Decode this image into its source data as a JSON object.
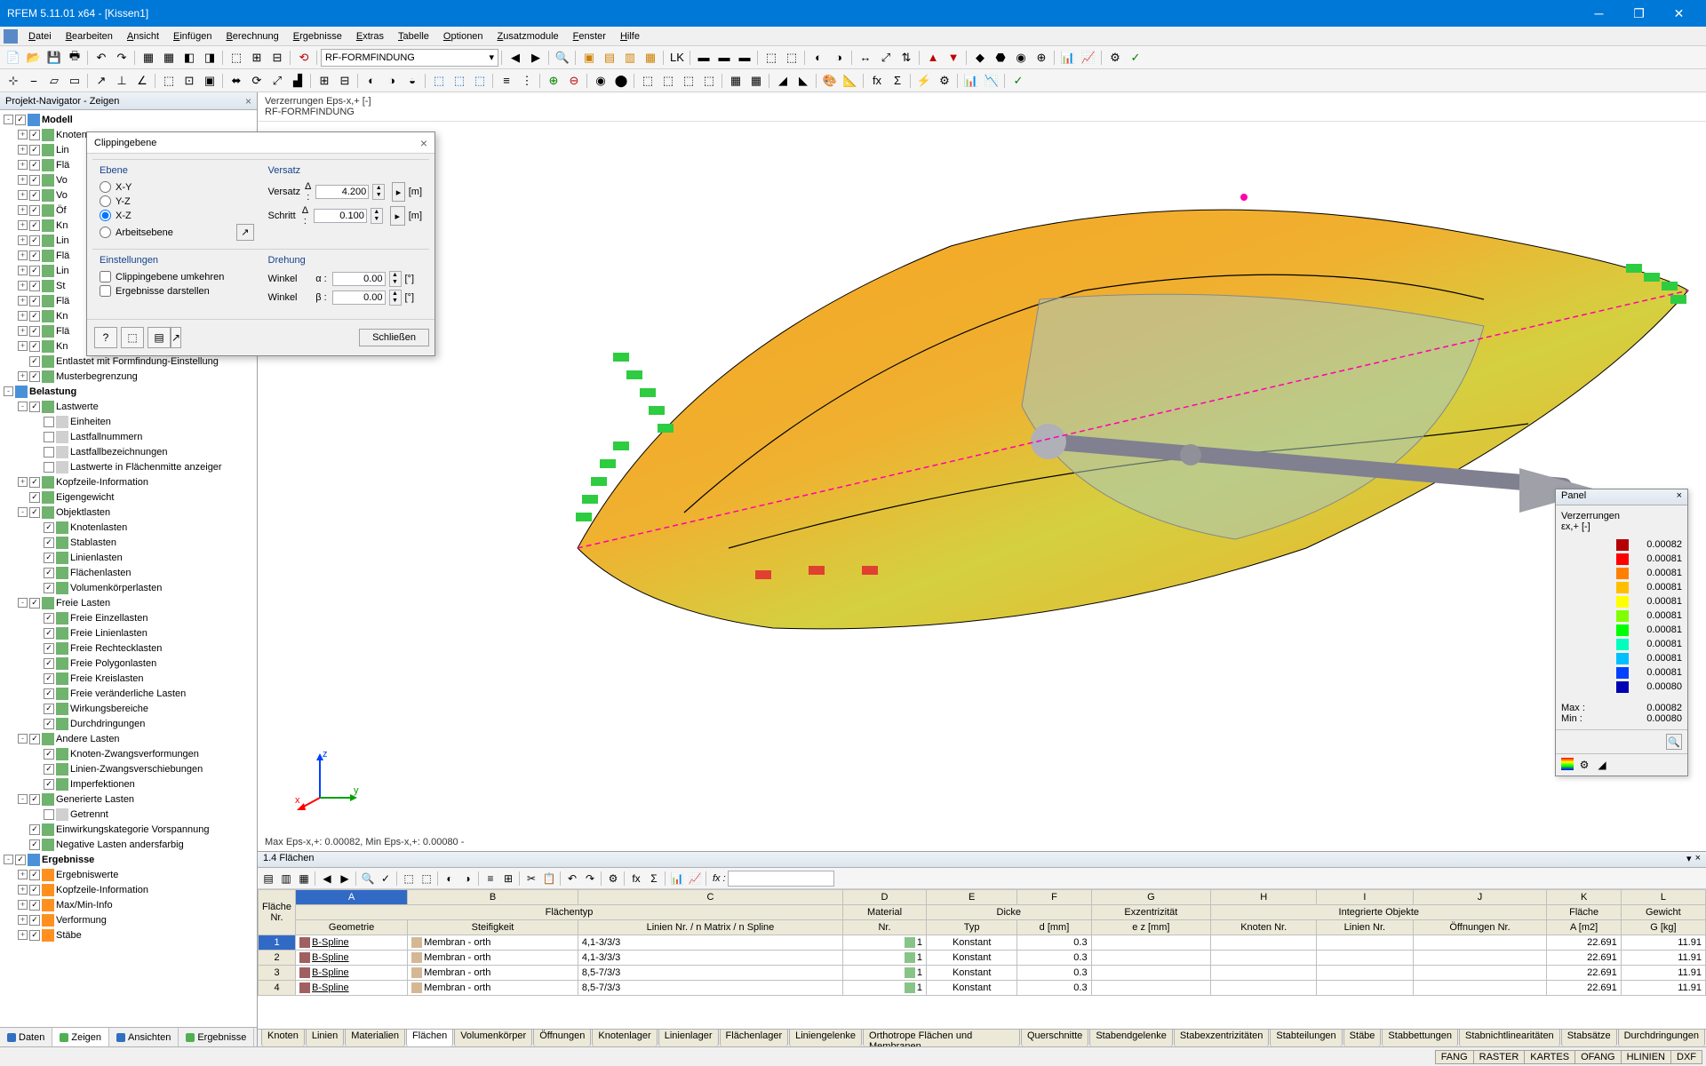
{
  "app": {
    "title": "RFEM 5.11.01 x64 - [Kissen1]"
  },
  "menu": [
    "Datei",
    "Bearbeiten",
    "Ansicht",
    "Einfügen",
    "Berechnung",
    "Ergebnisse",
    "Extras",
    "Tabelle",
    "Optionen",
    "Zusatzmodule",
    "Fenster",
    "Hilfe"
  ],
  "menu_accel": [
    "D",
    "B",
    "A",
    "E",
    "B",
    "E",
    "E",
    "T",
    "O",
    "Z",
    "F",
    "H"
  ],
  "module_dropdown": "RF-FORMFINDUNG",
  "navigator": {
    "title": "Projekt-Navigator - Zeigen",
    "tree": [
      {
        "d": 0,
        "tw": "-",
        "cb": true,
        "bold": true,
        "ic": "#4a90d9",
        "lbl": "Modell"
      },
      {
        "d": 1,
        "tw": "+",
        "cb": true,
        "ic": "#6fb36f",
        "lbl": "Knoten"
      },
      {
        "d": 1,
        "tw": "+",
        "cb": true,
        "ic": "#6fb36f",
        "lbl": "Lin"
      },
      {
        "d": 1,
        "tw": "+",
        "cb": true,
        "ic": "#6fb36f",
        "lbl": "Flä"
      },
      {
        "d": 1,
        "tw": "+",
        "cb": true,
        "ic": "#6fb36f",
        "lbl": "Vo"
      },
      {
        "d": 1,
        "tw": "+",
        "cb": true,
        "ic": "#6fb36f",
        "lbl": "Vo"
      },
      {
        "d": 1,
        "tw": "+",
        "cb": true,
        "ic": "#6fb36f",
        "lbl": "Öf"
      },
      {
        "d": 1,
        "tw": "+",
        "cb": true,
        "ic": "#6fb36f",
        "lbl": "Kn"
      },
      {
        "d": 1,
        "tw": "+",
        "cb": true,
        "ic": "#6fb36f",
        "lbl": "Lin"
      },
      {
        "d": 1,
        "tw": "+",
        "cb": true,
        "ic": "#6fb36f",
        "lbl": "Flä"
      },
      {
        "d": 1,
        "tw": "+",
        "cb": true,
        "ic": "#6fb36f",
        "lbl": "Lin"
      },
      {
        "d": 1,
        "tw": "+",
        "cb": true,
        "ic": "#6fb36f",
        "lbl": "St"
      },
      {
        "d": 1,
        "tw": "+",
        "cb": true,
        "ic": "#6fb36f",
        "lbl": "Flä"
      },
      {
        "d": 1,
        "tw": "+",
        "cb": true,
        "ic": "#6fb36f",
        "lbl": "Kn"
      },
      {
        "d": 1,
        "tw": "+",
        "cb": true,
        "ic": "#6fb36f",
        "lbl": "Flä"
      },
      {
        "d": 1,
        "tw": "+",
        "cb": true,
        "ic": "#6fb36f",
        "lbl": "Kn"
      },
      {
        "d": 1,
        "tw": " ",
        "cb": true,
        "ic": "#6fb36f",
        "lbl": "Entlastet mit Formfindung-Einstellung"
      },
      {
        "d": 1,
        "tw": "+",
        "cb": true,
        "ic": "#6fb36f",
        "lbl": "Musterbegrenzung"
      },
      {
        "d": 0,
        "tw": "-",
        "cb": null,
        "bold": true,
        "ic": "#4a90d9",
        "lbl": "Belastung"
      },
      {
        "d": 1,
        "tw": "-",
        "cb": true,
        "ic": "#6fb36f",
        "lbl": "Lastwerte"
      },
      {
        "d": 2,
        "tw": " ",
        "cb": false,
        "ic": "#d0d0d0",
        "lbl": "Einheiten"
      },
      {
        "d": 2,
        "tw": " ",
        "cb": false,
        "ic": "#d0d0d0",
        "lbl": "Lastfallnummern"
      },
      {
        "d": 2,
        "tw": " ",
        "cb": false,
        "ic": "#d0d0d0",
        "lbl": "Lastfallbezeichnungen"
      },
      {
        "d": 2,
        "tw": " ",
        "cb": false,
        "ic": "#d0d0d0",
        "lbl": "Lastwerte in Flächenmitte anzeiger"
      },
      {
        "d": 1,
        "tw": "+",
        "cb": true,
        "ic": "#6fb36f",
        "lbl": "Kopfzeile-Information"
      },
      {
        "d": 1,
        "tw": " ",
        "cb": true,
        "ic": "#6fb36f",
        "lbl": "Eigengewicht"
      },
      {
        "d": 1,
        "tw": "-",
        "cb": true,
        "ic": "#6fb36f",
        "lbl": "Objektlasten"
      },
      {
        "d": 2,
        "tw": " ",
        "cb": true,
        "ic": "#6fb36f",
        "lbl": "Knotenlasten"
      },
      {
        "d": 2,
        "tw": " ",
        "cb": true,
        "ic": "#6fb36f",
        "lbl": "Stablasten"
      },
      {
        "d": 2,
        "tw": " ",
        "cb": true,
        "ic": "#6fb36f",
        "lbl": "Linienlasten"
      },
      {
        "d": 2,
        "tw": " ",
        "cb": true,
        "ic": "#6fb36f",
        "lbl": "Flächenlasten"
      },
      {
        "d": 2,
        "tw": " ",
        "cb": true,
        "ic": "#6fb36f",
        "lbl": "Volumenkörperlasten"
      },
      {
        "d": 1,
        "tw": "-",
        "cb": true,
        "ic": "#6fb36f",
        "lbl": "Freie Lasten"
      },
      {
        "d": 2,
        "tw": " ",
        "cb": true,
        "ic": "#6fb36f",
        "lbl": "Freie Einzellasten"
      },
      {
        "d": 2,
        "tw": " ",
        "cb": true,
        "ic": "#6fb36f",
        "lbl": "Freie Linienlasten"
      },
      {
        "d": 2,
        "tw": " ",
        "cb": true,
        "ic": "#6fb36f",
        "lbl": "Freie Rechtecklasten"
      },
      {
        "d": 2,
        "tw": " ",
        "cb": true,
        "ic": "#6fb36f",
        "lbl": "Freie Polygonlasten"
      },
      {
        "d": 2,
        "tw": " ",
        "cb": true,
        "ic": "#6fb36f",
        "lbl": "Freie Kreislasten"
      },
      {
        "d": 2,
        "tw": " ",
        "cb": true,
        "ic": "#6fb36f",
        "lbl": "Freie veränderliche Lasten"
      },
      {
        "d": 2,
        "tw": " ",
        "cb": true,
        "ic": "#6fb36f",
        "lbl": "Wirkungsbereiche"
      },
      {
        "d": 2,
        "tw": " ",
        "cb": true,
        "ic": "#6fb36f",
        "lbl": "Durchdringungen"
      },
      {
        "d": 1,
        "tw": "-",
        "cb": true,
        "ic": "#6fb36f",
        "lbl": "Andere Lasten"
      },
      {
        "d": 2,
        "tw": " ",
        "cb": true,
        "ic": "#6fb36f",
        "lbl": "Knoten-Zwangsverformungen"
      },
      {
        "d": 2,
        "tw": " ",
        "cb": true,
        "ic": "#6fb36f",
        "lbl": "Linien-Zwangsverschiebungen"
      },
      {
        "d": 2,
        "tw": " ",
        "cb": true,
        "ic": "#6fb36f",
        "lbl": "Imperfektionen"
      },
      {
        "d": 1,
        "tw": "-",
        "cb": true,
        "ic": "#6fb36f",
        "lbl": "Generierte Lasten"
      },
      {
        "d": 2,
        "tw": " ",
        "cb": false,
        "ic": "#d0d0d0",
        "lbl": "Getrennt"
      },
      {
        "d": 1,
        "tw": " ",
        "cb": true,
        "ic": "#6fb36f",
        "lbl": "Einwirkungskategorie Vorspannung"
      },
      {
        "d": 1,
        "tw": " ",
        "cb": true,
        "ic": "#6fb36f",
        "lbl": "Negative Lasten andersfarbig"
      },
      {
        "d": 0,
        "tw": "-",
        "cb": true,
        "bold": true,
        "ic": "#4a90d9",
        "lbl": "Ergebnisse"
      },
      {
        "d": 1,
        "tw": "+",
        "cb": true,
        "ic": "#ff9020",
        "lbl": "Ergebniswerte"
      },
      {
        "d": 1,
        "tw": "+",
        "cb": true,
        "ic": "#ff9020",
        "lbl": "Kopfzeile-Information"
      },
      {
        "d": 1,
        "tw": "+",
        "cb": true,
        "ic": "#ff9020",
        "lbl": "Max/Min-Info"
      },
      {
        "d": 1,
        "tw": "+",
        "cb": true,
        "ic": "#ff9020",
        "lbl": "Verformung"
      },
      {
        "d": 1,
        "tw": "+",
        "cb": true,
        "ic": "#ff9020",
        "lbl": "Stäbe"
      }
    ],
    "bottom_tabs": [
      {
        "lbl": "Daten",
        "c": "#3070c0"
      },
      {
        "lbl": "Zeigen",
        "c": "#50b050",
        "active": true
      },
      {
        "lbl": "Ansichten",
        "c": "#3070c0"
      },
      {
        "lbl": "Ergebnisse",
        "c": "#50b050"
      }
    ]
  },
  "viewport": {
    "header_line1": "Verzerrungen Eps-x,+ [-]",
    "header_line2": "RF-FORMFINDUNG",
    "status": "Max Eps-x,+: 0.00082, Min Eps-x,+: 0.00080 -"
  },
  "dialog": {
    "title": "Clippingebene",
    "groups": {
      "ebene": "Ebene",
      "versatz": "Versatz",
      "einst": "Einstellungen",
      "drehung": "Drehung"
    },
    "ebene_opts": [
      "X-Y",
      "Y-Z",
      "X-Z",
      "Arbeitsebene"
    ],
    "ebene_sel": 2,
    "versatz": {
      "lbl": "Versatz",
      "sym": "Δ :",
      "val": "4.200",
      "unit": "[m]"
    },
    "schritt": {
      "lbl": "Schritt",
      "sym": "Δ :",
      "val": "0.100",
      "unit": "[m]"
    },
    "chk1": "Clippingebene umkehren",
    "chk2": "Ergebnisse darstellen",
    "winkel_a": {
      "lbl": "Winkel",
      "sym": "α :",
      "val": "0.00",
      "unit": "[°]"
    },
    "winkel_b": {
      "lbl": "Winkel",
      "sym": "β :",
      "val": "0.00",
      "unit": "[°]"
    },
    "close": "Schließen"
  },
  "panel": {
    "title": "Panel",
    "heading": "Verzerrungen",
    "sub": "εx,+ [-]",
    "legend": [
      {
        "c": "#b40000",
        "v": "0.00082"
      },
      {
        "c": "#ff0000",
        "v": "0.00081"
      },
      {
        "c": "#ff8000",
        "v": "0.00081"
      },
      {
        "c": "#ffbf00",
        "v": "0.00081"
      },
      {
        "c": "#ffff00",
        "v": "0.00081"
      },
      {
        "c": "#80ff00",
        "v": "0.00081"
      },
      {
        "c": "#00ff00",
        "v": "0.00081"
      },
      {
        "c": "#00ffbf",
        "v": "0.00081"
      },
      {
        "c": "#00bfff",
        "v": "0.00081"
      },
      {
        "c": "#0040ff",
        "v": "0.00081"
      },
      {
        "c": "#0000b4",
        "v": "0.00080"
      }
    ],
    "max_lbl": "Max  :",
    "max": "0.00082",
    "min_lbl": "Min   :",
    "min": "0.00080"
  },
  "table": {
    "title": "1.4 Flächen",
    "letters": [
      "A",
      "B",
      "C",
      "D",
      "E",
      "F",
      "G",
      "H",
      "I",
      "J",
      "K",
      "L"
    ],
    "group_headers": {
      "flache": "Fläche",
      "flachentyp": "Flächentyp",
      "material": "Material",
      "dicke": "Dicke",
      "exz": "Exzentrizität",
      "integ": "Integrierte Objekte",
      "flaeche2": "Fläche",
      "gewicht": "Gewicht"
    },
    "headers": {
      "nr": "Nr.",
      "geom": "Geometrie",
      "steif": "Steifigkeit",
      "linien": "Linien Nr. / n Matrix / n Spline",
      "mnr": "Nr.",
      "typ": "Typ",
      "d": "d [mm]",
      "ez": "e z [mm]",
      "knoten": "Knoten Nr.",
      "liniennr": "Linien Nr.",
      "oeff": "Öffnungen Nr.",
      "a": "A [m2]",
      "g": "G [kg]"
    },
    "rows": [
      {
        "n": 1,
        "sel": true,
        "geom_c": "#a06060",
        "geom": "B-Spline",
        "steif_c": "#d4b896",
        "steif": "Membran - orth",
        "lin": "4,1-3/3/3",
        "mat_c": "#88c488",
        "mat": "1",
        "typ": "Konstant",
        "d": "0.3",
        "a": "22.691",
        "g": "11.91"
      },
      {
        "n": 2,
        "geom_c": "#a06060",
        "geom": "B-Spline",
        "steif_c": "#d4b896",
        "steif": "Membran - orth",
        "lin": "4,1-3/3/3",
        "mat_c": "#88c488",
        "mat": "1",
        "typ": "Konstant",
        "d": "0.3",
        "a": "22.691",
        "g": "11.91"
      },
      {
        "n": 3,
        "geom_c": "#a06060",
        "geom": "B-Spline",
        "steif_c": "#d4b896",
        "steif": "Membran - orth",
        "lin": "8,5-7/3/3",
        "mat_c": "#88c488",
        "mat": "1",
        "typ": "Konstant",
        "d": "0.3",
        "a": "22.691",
        "g": "11.91"
      },
      {
        "n": 4,
        "geom_c": "#a06060",
        "geom": "B-Spline",
        "steif_c": "#d4b896",
        "steif": "Membran - orth",
        "lin": "8,5-7/3/3",
        "mat_c": "#88c488",
        "mat": "1",
        "typ": "Konstant",
        "d": "0.3",
        "a": "22.691",
        "g": "11.91"
      }
    ],
    "fx_label": "fx :"
  },
  "bottom_tabs": [
    "Knoten",
    "Linien",
    "Materialien",
    "Flächen",
    "Volumenkörper",
    "Öffnungen",
    "Knotenlager",
    "Linienlager",
    "Flächenlager",
    "Liniengelenke",
    "Orthotrope Flächen und Membranen",
    "Querschnitte",
    "Stabendgelenke",
    "Stabexzentrizitäten",
    "Stabteilungen",
    "Stäbe",
    "Stabbettungen",
    "Stabnichtlinearitäten",
    "Stabsätze",
    "Durchdringungen"
  ],
  "bottom_tab_active": 3,
  "status_items": [
    "FANG",
    "RASTER",
    "KARTES",
    "OFANG",
    "HLINIEN",
    "DXF"
  ]
}
